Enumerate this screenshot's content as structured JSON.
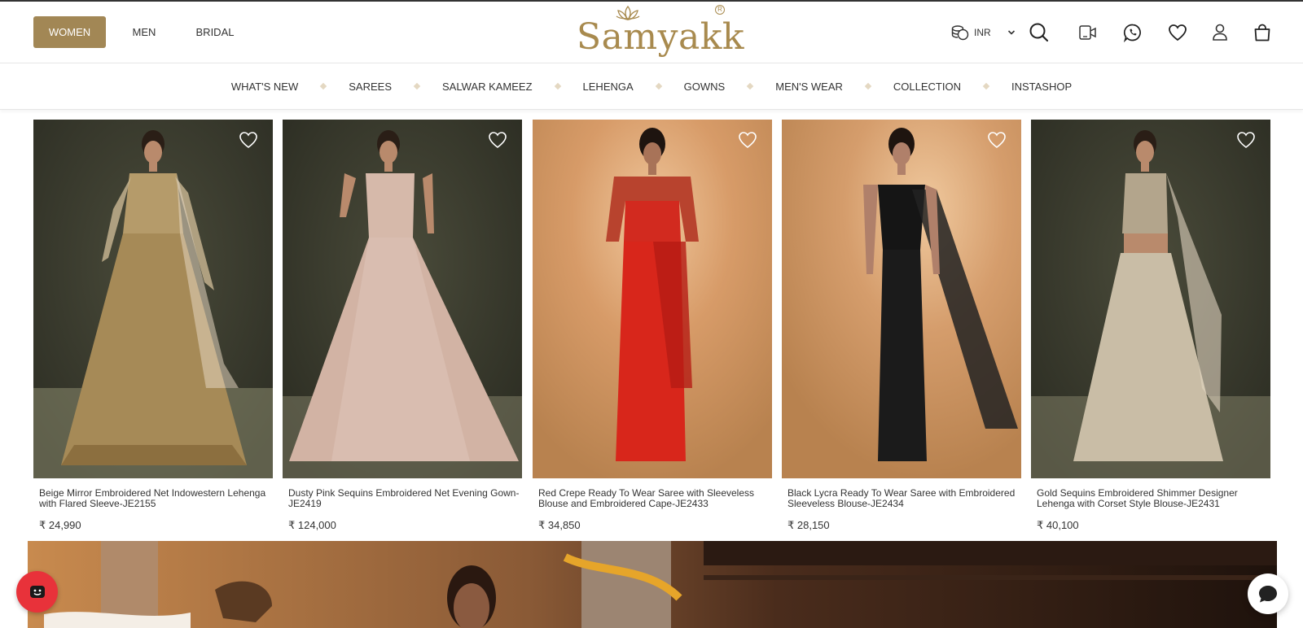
{
  "header": {
    "gender_tabs": [
      {
        "label": "WOMEN",
        "active": true
      },
      {
        "label": "MEN",
        "active": false
      },
      {
        "label": "BRIDAL",
        "active": false
      }
    ],
    "logo_text": "Samyakk",
    "logo_reg": "R",
    "currency": "INR",
    "icons": [
      "currency-coins-icon",
      "chevron-down-icon",
      "search-icon",
      "video-call-icon",
      "whatsapp-icon",
      "heart-icon",
      "user-icon",
      "bag-icon"
    ]
  },
  "nav": {
    "items": [
      "WHAT'S NEW",
      "SAREES",
      "SALWAR KAMEEZ",
      "LEHENGA",
      "GOWNS",
      "MEN'S WEAR",
      "COLLECTION",
      "INSTASHOP"
    ]
  },
  "products": [
    {
      "title": "Beige Mirror Embroidered Net Indowestern Lehenga with Flared Sleeve-JE2155",
      "price": "₹ 24,990"
    },
    {
      "title": "Dusty Pink Sequins Embroidered Net Evening Gown-JE2419",
      "price": "₹ 124,000"
    },
    {
      "title": "Red Crepe Ready To Wear Saree with Sleeveless Blouse and Embroidered Cape-JE2433",
      "price": "₹ 34,850"
    },
    {
      "title": "Black Lycra Ready To Wear Saree with Embroidered Sleeveless Blouse-JE2434",
      "price": "₹ 28,150"
    },
    {
      "title": "Gold Sequins Embroidered Shimmer Designer Lehenga with Corset Style Blouse-JE2431",
      "price": "₹ 40,100"
    }
  ],
  "colors": {
    "accent": "#a28755",
    "logo": "#a88a4e",
    "chat_button": "#e8323a"
  }
}
